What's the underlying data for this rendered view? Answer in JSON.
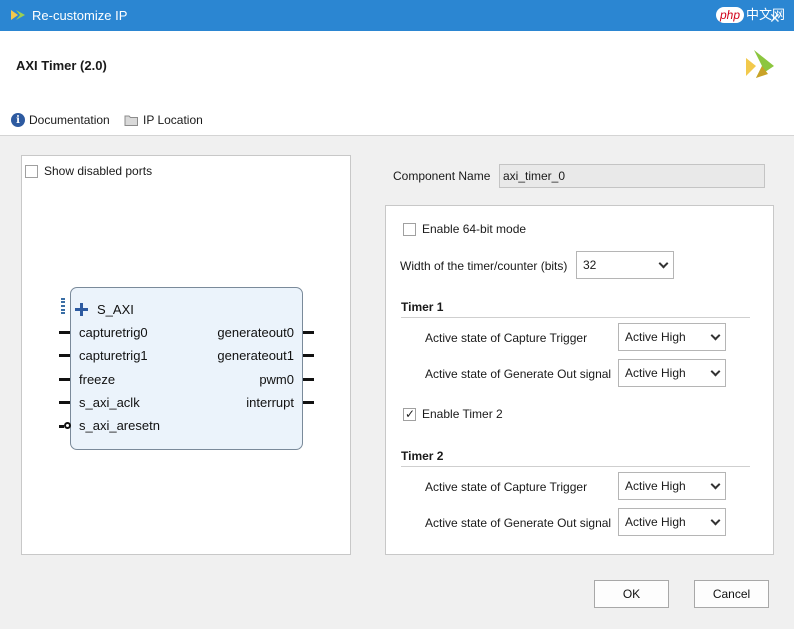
{
  "window": {
    "title": "Re-customize IP",
    "watermark_badge": "php",
    "watermark_text": "中文网",
    "close_glyph": "✕"
  },
  "header": {
    "ip_title": "AXI Timer (2.0)",
    "logo_icon": "vivado-logo-icon"
  },
  "toolbar": {
    "documentation_label": "Documentation",
    "documentation_icon": "info-icon",
    "ip_location_label": "IP Location",
    "ip_location_icon": "folder-icon"
  },
  "symbol": {
    "show_disabled_ports_label": "Show disabled ports",
    "show_disabled_ports_checked": false,
    "bus_port": "S_AXI",
    "left_ports": [
      "capturetrig0",
      "capturetrig1",
      "freeze",
      "s_axi_aclk",
      "s_axi_aresetn"
    ],
    "right_ports": [
      "generateout0",
      "generateout1",
      "pwm0",
      "interrupt"
    ]
  },
  "config": {
    "component_name_label": "Component Name",
    "component_name_value": "axi_timer_0",
    "enable_64bit_label": "Enable 64-bit mode",
    "enable_64bit_checked": false,
    "width_label": "Width of the timer/counter (bits)",
    "width_value": "32",
    "timer1": {
      "title": "Timer 1",
      "capture_trigger_label": "Active state of Capture Trigger",
      "capture_trigger_value": "Active High",
      "generate_out_label": "Active state of Generate Out signal",
      "generate_out_value": "Active High"
    },
    "enable_timer2_label": "Enable Timer 2",
    "enable_timer2_checked": true,
    "timer2": {
      "title": "Timer 2",
      "capture_trigger_label": "Active state of Capture Trigger",
      "capture_trigger_value": "Active High",
      "generate_out_label": "Active state of Generate Out signal",
      "generate_out_value": "Active High"
    }
  },
  "buttons": {
    "ok_label": "OK",
    "cancel_label": "Cancel"
  },
  "colors": {
    "titlebar": "#2b86d2",
    "block_fill": "#ebf3fb",
    "accent": "#2d5aa0"
  }
}
